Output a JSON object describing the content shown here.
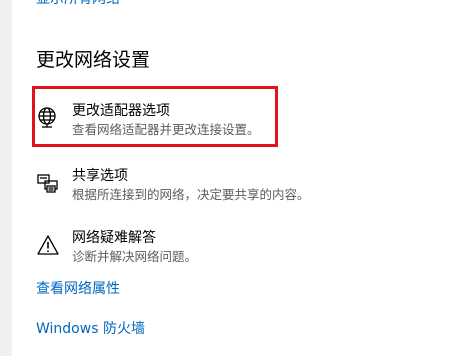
{
  "top_partial_link": {
    "label": "显示所有网络"
  },
  "section": {
    "title": "更改网络设置"
  },
  "options": [
    {
      "icon": "adapter-globe-icon",
      "title": "更改适配器选项",
      "description": "查看网络适配器并更改连接设置。"
    },
    {
      "icon": "sharing-printer-icon",
      "title": "共享选项",
      "description": "根据所连接到的网络，决定要共享的内容。"
    },
    {
      "icon": "warning-icon",
      "title": "网络疑难解答",
      "description": "诊断并解决网络问题。"
    }
  ],
  "links": {
    "network_properties": "查看网络属性",
    "firewall": "Windows 防火墙"
  },
  "colors": {
    "link": "#0067c0",
    "highlight": "#e0131b",
    "description": "#5d5d5d"
  }
}
